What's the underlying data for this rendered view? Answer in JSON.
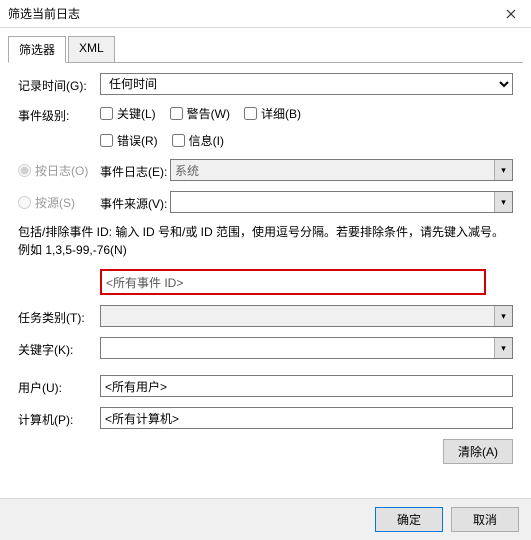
{
  "window": {
    "title": "筛选当前日志"
  },
  "tabs": {
    "filter": "筛选器",
    "xml": "XML"
  },
  "form": {
    "logTime": {
      "label": "记录时间(G):",
      "value": "任何时间"
    },
    "eventLevel": {
      "label": "事件级别:",
      "checks": {
        "critical": "关键(L)",
        "warning": "警告(W)",
        "verbose": "详细(B)",
        "error": "错误(R)",
        "info": "信息(I)"
      }
    },
    "radios": {
      "byLog": "按日志(O)",
      "bySource": "按源(S)"
    },
    "eventLog": {
      "label": "事件日志(E):",
      "value": "系统"
    },
    "eventSource": {
      "label": "事件来源(V):",
      "value": ""
    },
    "helpText": "包括/排除事件 ID: 输入 ID 号和/或 ID 范围，使用逗号分隔。若要排除条件，请先键入减号。例如 1,3,5-99,-76(N)",
    "eventIds": {
      "placeholder": "<所有事件 ID>"
    },
    "taskCategory": {
      "label": "任务类别(T):",
      "value": ""
    },
    "keywords": {
      "label": "关键字(K):",
      "value": ""
    },
    "user": {
      "label": "用户(U):",
      "value": "<所有用户>"
    },
    "computer": {
      "label": "计算机(P):",
      "value": "<所有计算机>"
    },
    "clear": "清除(A)"
  },
  "footer": {
    "ok": "确定",
    "cancel": "取消"
  }
}
